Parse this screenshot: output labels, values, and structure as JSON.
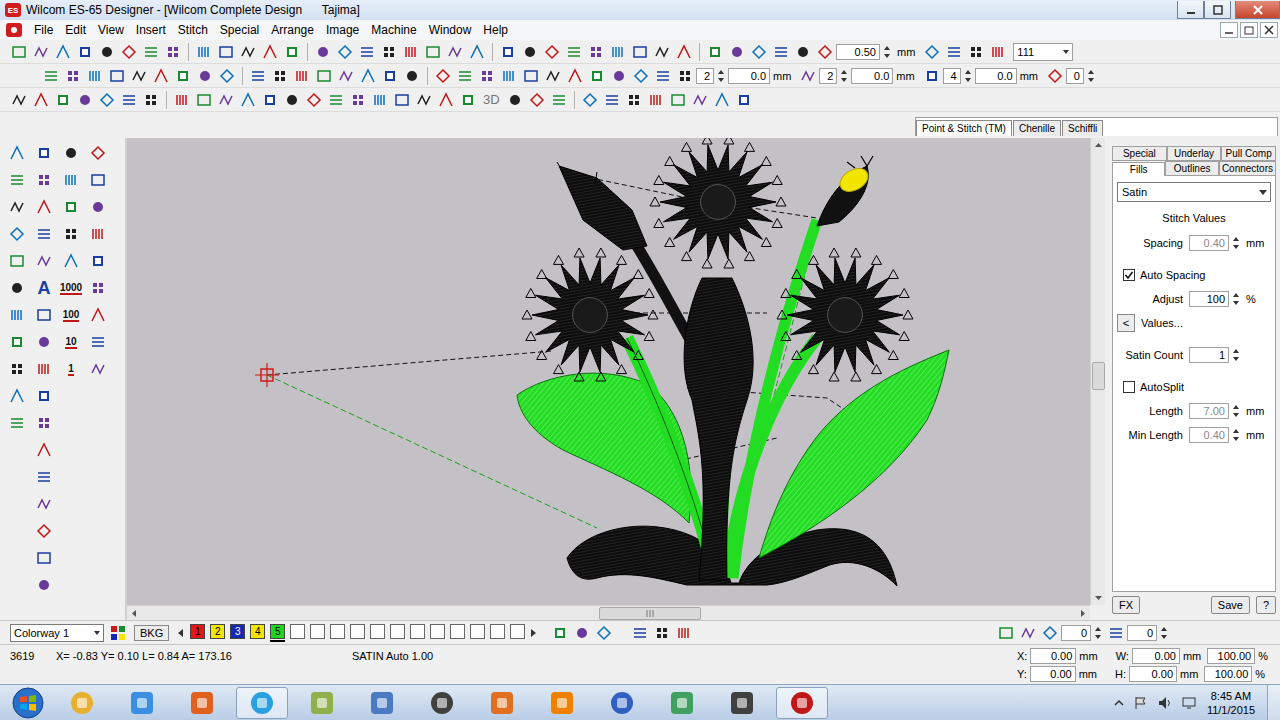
{
  "window": {
    "title": "Wilcom ES-65 Designer - [Wilcom Complete Design      Tajima]",
    "app_icon": "ES"
  },
  "menu": [
    "File",
    "Edit",
    "View",
    "Insert",
    "Stitch",
    "Special",
    "Arrange",
    "Image",
    "Machine",
    "Window",
    "Help"
  ],
  "toolbar1": {
    "zoom": "0.50",
    "zoom_unit": "mm",
    "zoom_percent": "111"
  },
  "toolbar2": {
    "fields": [
      {
        "value": "2"
      },
      {
        "value": "0.0",
        "unit": "mm"
      },
      {
        "value": "2"
      },
      {
        "value": "0.0",
        "unit": "mm"
      },
      {
        "value": "4"
      },
      {
        "value": "0.0",
        "unit": "mm"
      },
      {
        "value": "0"
      }
    ]
  },
  "toolbar3": {
    "label": "3D"
  },
  "mode_tabs": [
    {
      "label": "Point & Stitch (TM)",
      "selected": true
    },
    {
      "label": "Chenille",
      "selected": false
    },
    {
      "label": "Schiffli",
      "selected": false
    }
  ],
  "toolbox": {
    "labels": [
      "A",
      "1000",
      "100",
      "10",
      "1"
    ]
  },
  "properties": {
    "tabs_top": [
      {
        "label": "Special",
        "selected": false
      },
      {
        "label": "Underlay",
        "selected": false
      },
      {
        "label": "Pull Comp",
        "selected": false
      }
    ],
    "tabs_bottom": [
      {
        "label": "Fills",
        "selected": true
      },
      {
        "label": "Outlines",
        "selected": false
      },
      {
        "label": "Connectors",
        "selected": false
      }
    ],
    "fill_type": "Satin",
    "section": "Stitch Values",
    "rows": [
      {
        "kind": "field",
        "label": "Spacing",
        "value": "0.40",
        "unit": "mm",
        "disabled": true
      },
      {
        "kind": "checkbox",
        "label": "Auto Spacing",
        "checked": true
      },
      {
        "kind": "field",
        "label": "Adjust",
        "value": "100",
        "unit": "%",
        "disabled": false
      },
      {
        "kind": "button",
        "icon": "<",
        "label": "Values..."
      },
      {
        "kind": "field",
        "label": "Satin Count",
        "value": "1",
        "disabled": false
      },
      {
        "kind": "checkbox",
        "label": "AutoSplit",
        "checked": false
      },
      {
        "kind": "field",
        "label": "Length",
        "value": "7.00",
        "unit": "mm",
        "disabled": true
      },
      {
        "kind": "field",
        "label": "Min Length",
        "value": "0.40",
        "unit": "mm",
        "disabled": true
      }
    ],
    "buttons": [
      "FX",
      "Save",
      "?"
    ]
  },
  "colorway": {
    "select": "Colorway 1",
    "bkg": "BKG",
    "swatches": [
      {
        "label": "1",
        "color": "#e01818",
        "selected": false
      },
      {
        "label": "2",
        "color": "#f2e600",
        "selected": false
      },
      {
        "label": "3",
        "color": "#1428b4",
        "selected": false
      },
      {
        "label": "4",
        "color": "#f2e600",
        "selected": false
      },
      {
        "label": "5",
        "color": "#22d422",
        "selected": true
      }
    ],
    "fields": [
      "0",
      "0"
    ]
  },
  "status_bar": {
    "count": "3619",
    "coords": "X= -0.83 Y= 0.10 L= 0.84 A= 173.16",
    "stitch": "SATIN Auto 1.00",
    "rows": [
      {
        "pos_label": "X:",
        "pos": "0.00",
        "pos_unit": "mm",
        "size_label": "W:",
        "size": "0.00",
        "size_unit": "mm",
        "scale": "100.00",
        "scale_unit": "%"
      },
      {
        "pos_label": "Y:",
        "pos": "0.00",
        "pos_unit": "mm",
        "size_label": "H:",
        "size": "0.00",
        "size_unit": "mm",
        "scale": "100.00",
        "scale_unit": "%"
      }
    ]
  },
  "taskbar": {
    "time": "8:45 AM",
    "date": "11/1/2015"
  }
}
